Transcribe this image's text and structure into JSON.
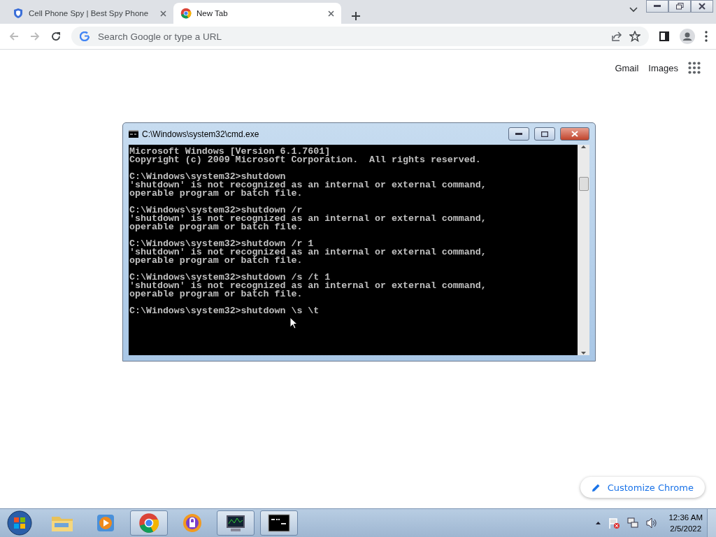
{
  "browser": {
    "tabs": [
      {
        "title": "Cell Phone Spy | Best Spy Phone",
        "kind": "shield",
        "selected": false
      },
      {
        "title": "New Tab",
        "kind": "chrome",
        "selected": true
      }
    ],
    "address": {
      "placeholder": "Search Google or type a URL"
    },
    "top_links": [
      "Gmail",
      "Images"
    ],
    "customize_button": "Customize Chrome"
  },
  "console_window": {
    "title": "C:\\Windows\\system32\\cmd.exe",
    "blocks": [
      [
        "Microsoft Windows [Version 6.1.7601]",
        "Copyright (c) 2009 Microsoft Corporation.  All rights reserved."
      ],
      [
        "C:\\Windows\\system32>shutdown",
        "'shutdown' is not recognized as an internal or external command,",
        "operable program or batch file."
      ],
      [
        "C:\\Windows\\system32>shutdown /r",
        "'shutdown' is not recognized as an internal or external command,",
        "operable program or batch file."
      ],
      [
        "C:\\Windows\\system32>shutdown /r 1",
        "'shutdown' is not recognized as an internal or external command,",
        "operable program or batch file."
      ],
      [
        "C:\\Windows\\system32>shutdown /s /t 1",
        "'shutdown' is not recognized as an internal or external command,",
        "operable program or batch file."
      ],
      [
        "C:\\Windows\\system32>shutdown \\s \\t"
      ]
    ]
  },
  "taskbar": {
    "apps": [
      {
        "kind": "folder",
        "running": false
      },
      {
        "kind": "media",
        "running": false
      },
      {
        "kind": "chrome",
        "running": true
      },
      {
        "kind": "lock",
        "running": false
      },
      {
        "kind": "monitor",
        "running": true
      },
      {
        "kind": "console",
        "running": true
      }
    ],
    "time": "12:36 AM",
    "date": "2/5/2022"
  }
}
